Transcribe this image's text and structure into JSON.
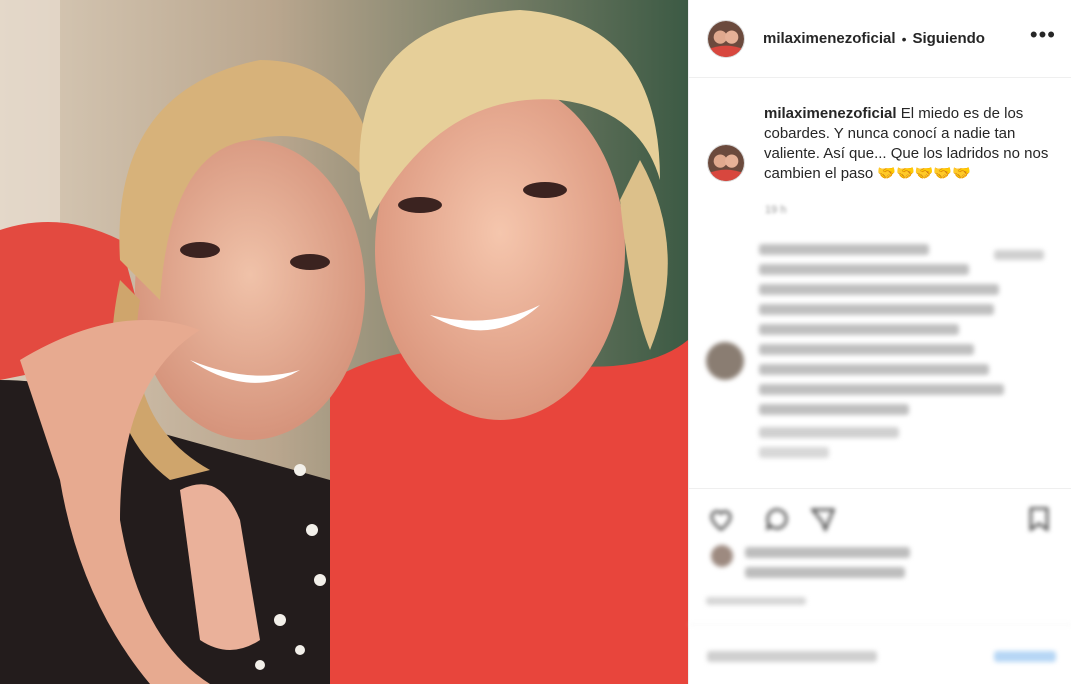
{
  "post": {
    "username": "milaximenezoficial",
    "separator": "•",
    "follow_status": "Siguiendo",
    "more_label": "•••",
    "caption_text": "El miedo es de los cobardes. Y nunca conocí a nadie tan valiente. Así que... Que los ladridos no nos cambien el paso 🤝🤝🤝🤝🤝",
    "time_ago": "19 h"
  },
  "icons": {
    "more": "more-options-icon",
    "like": "heart-icon",
    "comment": "comment-icon",
    "share": "share-icon",
    "save": "bookmark-icon"
  },
  "colors": {
    "border": "#efefef",
    "text": "#262626",
    "muted": "#999999"
  }
}
